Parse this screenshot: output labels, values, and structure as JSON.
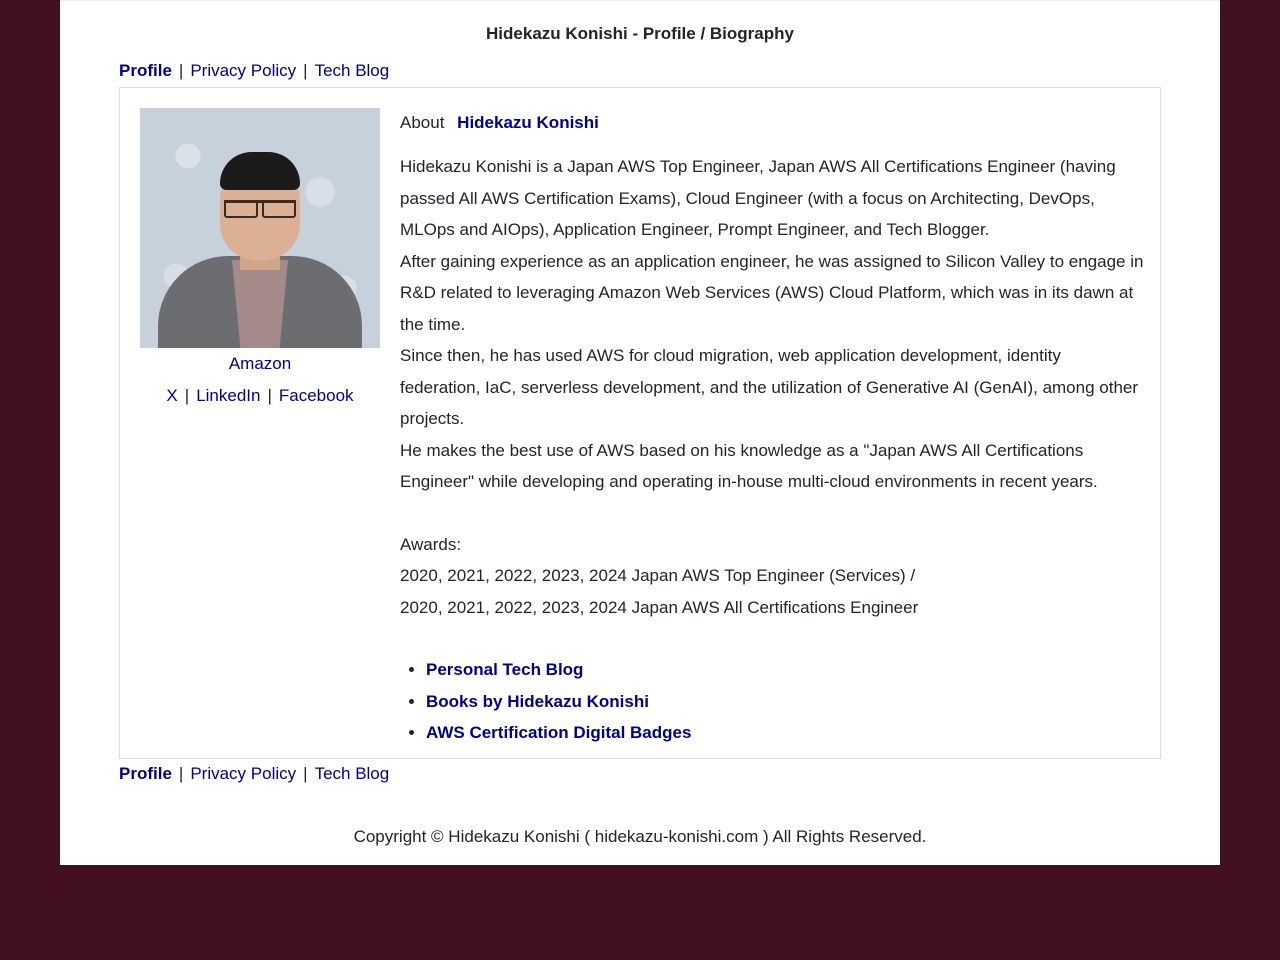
{
  "header": {
    "title": "Hidekazu Konishi - Profile / Biography"
  },
  "nav": {
    "items": [
      {
        "label": "Profile",
        "active": true
      },
      {
        "label": "Privacy Policy",
        "active": false
      },
      {
        "label": "Tech Blog",
        "active": false
      }
    ],
    "separator": "|"
  },
  "profile": {
    "photo_alt": "Hidekazu Konishi portrait",
    "amazon_label": "Amazon",
    "social": [
      {
        "label": "X"
      },
      {
        "label": "LinkedIn"
      },
      {
        "label": "Facebook"
      }
    ],
    "separator": "|"
  },
  "about": {
    "label": "About",
    "name": "Hidekazu Konishi",
    "bio": [
      "Hidekazu Konishi is a Japan AWS Top Engineer, Japan AWS All Certifications Engineer (having passed All AWS Certification Exams), Cloud Engineer (with a focus on Architecting, DevOps, MLOps and AIOps), Application Engineer, Prompt Engineer, and Tech Blogger.",
      "After gaining experience as an application engineer, he was assigned to Silicon Valley to engage in R&D related to leveraging Amazon Web Services (AWS) Cloud Platform, which was in its dawn at the time.",
      "Since then, he has used AWS for cloud migration, web application development, identity federation, IaC, serverless development, and the utilization of Generative AI (GenAI), among other projects.",
      "He makes the best use of AWS based on his knowledge as a \"Japan AWS All Certifications Engineer\" while developing and operating in-house multi-cloud environments in recent years."
    ],
    "awards_label": "Awards:",
    "awards": [
      "2020, 2021, 2022, 2023, 2024 Japan AWS Top Engineer (Services) /",
      "2020, 2021, 2022, 2023, 2024 Japan AWS All Certifications Engineer"
    ],
    "links": [
      {
        "label": "Personal Tech Blog"
      },
      {
        "label": "Books by Hidekazu Konishi"
      },
      {
        "label": "AWS Certification Digital Badges"
      }
    ]
  },
  "footer": {
    "copyright": "Copyright © Hidekazu Konishi ( hidekazu-konishi.com ) All Rights Reserved."
  },
  "colors": {
    "background": "#421020",
    "page": "#ffffff",
    "link": "#00008b",
    "text": "#212529",
    "card_border": "#dddddd"
  }
}
